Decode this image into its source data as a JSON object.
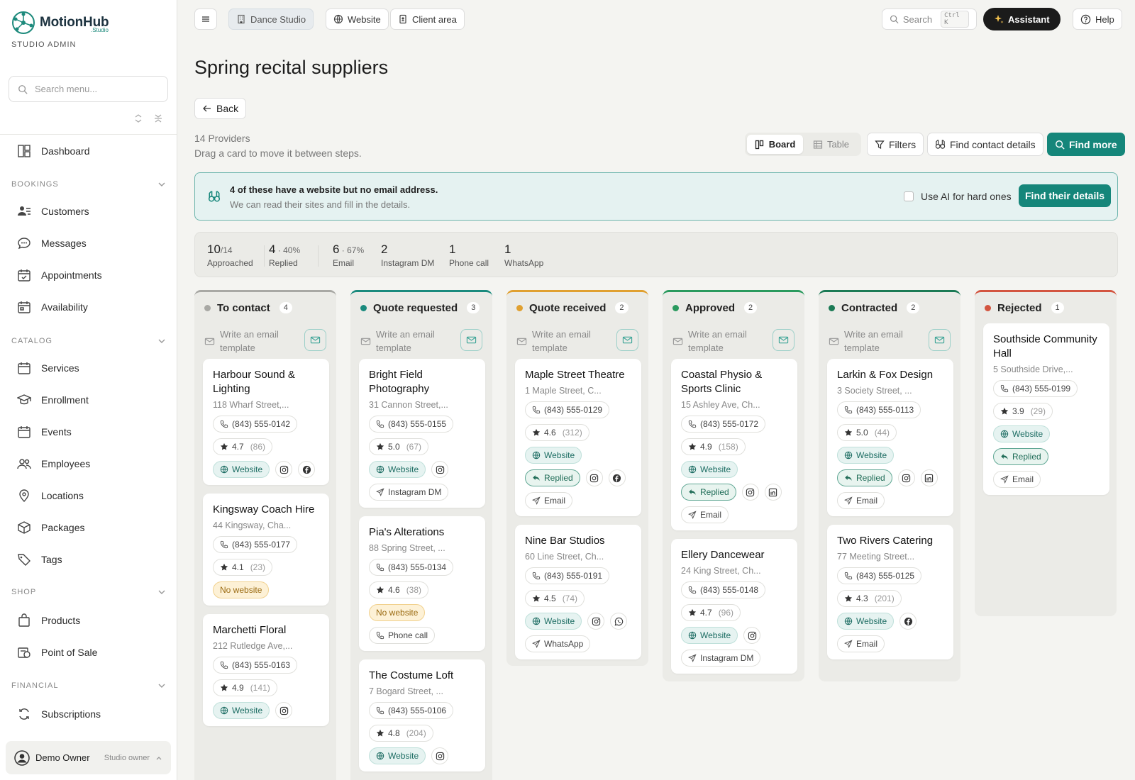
{
  "app": {
    "name": "MotionHub",
    "sub": ".Studio",
    "role_label": "STUDIO ADMIN"
  },
  "sidebar": {
    "search_placeholder": "Search menu...",
    "items": {
      "dashboard": "Dashboard",
      "customers": "Customers",
      "messages": "Messages",
      "appointments": "Appointments",
      "availability": "Availability",
      "services": "Services",
      "enrollment": "Enrollment",
      "events": "Events",
      "employees": "Employees",
      "locations": "Locations",
      "packages": "Packages",
      "tags": "Tags",
      "products": "Products",
      "pos": "Point of Sale",
      "subscriptions": "Subscriptions"
    },
    "sections": {
      "bookings": "BOOKINGS",
      "catalog": "CATALOG",
      "shop": "SHOP",
      "financial": "FINANCIAL"
    },
    "profile": {
      "name": "Demo Owner",
      "role": "Studio owner"
    }
  },
  "topbar": {
    "studio": "Dance Studio",
    "website": "Website",
    "client_area": "Client area",
    "search": "Search",
    "search_kbd": "Ctrl K",
    "assistant": "Assistant",
    "help": "Help"
  },
  "page": {
    "title": "Spring recital suppliers",
    "back": "Back",
    "providers": "14 Providers",
    "drag_hint": "Drag a card to move it between steps.",
    "view_board": "Board",
    "view_table": "Table",
    "filters": "Filters",
    "find_contact": "Find contact details",
    "find_more": "Find more"
  },
  "banner": {
    "title": "4 of these have a website but no email address.",
    "sub": "We can read their sites and fill in the details.",
    "checkbox_label": "Use AI for hard ones",
    "button": "Find their details"
  },
  "stats": [
    {
      "big": "10",
      "small": "/14",
      "label": "Approached"
    },
    {
      "big": "4",
      "small": " · 40%",
      "label": "Replied"
    },
    {
      "big": "6",
      "small": " · 67%",
      "label": "Email"
    },
    {
      "big": "2",
      "small": "",
      "label": "Instagram DM"
    },
    {
      "big": "1",
      "small": "",
      "label": "Phone call"
    },
    {
      "big": "1",
      "small": "",
      "label": "WhatsApp"
    }
  ],
  "template_text": "Write an email template",
  "colors": {
    "accent": "#15867a",
    "to_contact": "#a8a8a4",
    "quote_requested": "#1a8a7d",
    "quote_received": "#e0a030",
    "approved": "#2a9a5e",
    "contracted": "#1b7a55",
    "rejected": "#d35540"
  },
  "columns": [
    {
      "key": "to_contact",
      "title": "To contact",
      "count": "4",
      "cards": [
        {
          "name": "Harbour Sound & Lighting",
          "addr": "118 Wharf Street,...",
          "phone": "(843) 555-0142",
          "rating": "4.7",
          "reviews": "(86)",
          "chips": [
            "website",
            "instagram",
            "facebook"
          ]
        },
        {
          "name": "Kingsway Coach Hire",
          "addr": "44 Kingsway, Cha...",
          "phone": "(843) 555-0177",
          "rating": "4.1",
          "reviews": "(23)",
          "chips": [
            "nowebsite"
          ]
        },
        {
          "name": "Marchetti Floral",
          "addr": "212 Rutledge Ave,...",
          "phone": "(843) 555-0163",
          "rating": "4.9",
          "reviews": "(141)",
          "chips": [
            "website",
            "instagram"
          ]
        }
      ]
    },
    {
      "key": "quote_requested",
      "title": "Quote requested",
      "count": "3",
      "cards": [
        {
          "name": "Bright Field Photography",
          "addr": "31 Cannon Street,...",
          "phone": "(843) 555-0155",
          "rating": "5.0",
          "reviews": "(67)",
          "chips": [
            "website",
            "instagram",
            "instagramdm"
          ]
        },
        {
          "name": "Pia's Alterations",
          "addr": "88 Spring Street, ...",
          "phone": "(843) 555-0134",
          "rating": "4.6",
          "reviews": "(38)",
          "chips": [
            "nowebsite",
            "phonecall"
          ]
        },
        {
          "name": "The Costume Loft",
          "addr": "7 Bogard Street, ...",
          "phone": "(843) 555-0106",
          "rating": "4.8",
          "reviews": "(204)",
          "chips": [
            "website",
            "instagram"
          ]
        }
      ]
    },
    {
      "key": "quote_received",
      "title": "Quote received",
      "count": "2",
      "cards": [
        {
          "name": "Maple Street Theatre",
          "addr": "1 Maple Street, C...",
          "phone": "(843) 555-0129",
          "rating": "4.6",
          "reviews": "(312)",
          "chips": [
            "website",
            "replied",
            "instagram",
            "facebook",
            "email"
          ]
        },
        {
          "name": "Nine Bar Studios",
          "addr": "60 Line Street, Ch...",
          "phone": "(843) 555-0191",
          "rating": "4.5",
          "reviews": "(74)",
          "chips": [
            "website",
            "instagram",
            "whatsappicon",
            "whatsapp"
          ]
        }
      ]
    },
    {
      "key": "approved",
      "title": "Approved",
      "count": "2",
      "cards": [
        {
          "name": "Coastal Physio & Sports Clinic",
          "addr": "15 Ashley Ave, Ch...",
          "phone": "(843) 555-0172",
          "rating": "4.9",
          "reviews": "(158)",
          "chips": [
            "website",
            "replied",
            "instagram",
            "linkedin",
            "email"
          ]
        },
        {
          "name": "Ellery Dancewear",
          "addr": "24 King Street, Ch...",
          "phone": "(843) 555-0148",
          "rating": "4.7",
          "reviews": "(96)",
          "chips": [
            "website",
            "instagram",
            "instagramdm"
          ]
        }
      ]
    },
    {
      "key": "contracted",
      "title": "Contracted",
      "count": "2",
      "cards": [
        {
          "name": "Larkin & Fox Design",
          "addr": "3 Society Street, ...",
          "phone": "(843) 555-0113",
          "rating": "5.0",
          "reviews": "(44)",
          "chips": [
            "website",
            "replied",
            "instagram",
            "linkedin",
            "email"
          ]
        },
        {
          "name": "Two Rivers Catering",
          "addr": "77 Meeting Street...",
          "phone": "(843) 555-0125",
          "rating": "4.3",
          "reviews": "(201)",
          "chips": [
            "website",
            "facebook",
            "email"
          ]
        }
      ]
    },
    {
      "key": "rejected",
      "title": "Rejected",
      "count": "1",
      "cards": [
        {
          "name": "Southside Community Hall",
          "addr": "5 Southside Drive,...",
          "phone": "(843) 555-0199",
          "rating": "3.9",
          "reviews": "(29)",
          "chips": [
            "website",
            "replied",
            "email"
          ]
        }
      ]
    }
  ],
  "chip_labels": {
    "website": "Website",
    "nowebsite": "No website",
    "replied": "Replied",
    "email": "Email",
    "instagramdm": "Instagram DM",
    "phonecall": "Phone call",
    "whatsapp": "WhatsApp"
  }
}
